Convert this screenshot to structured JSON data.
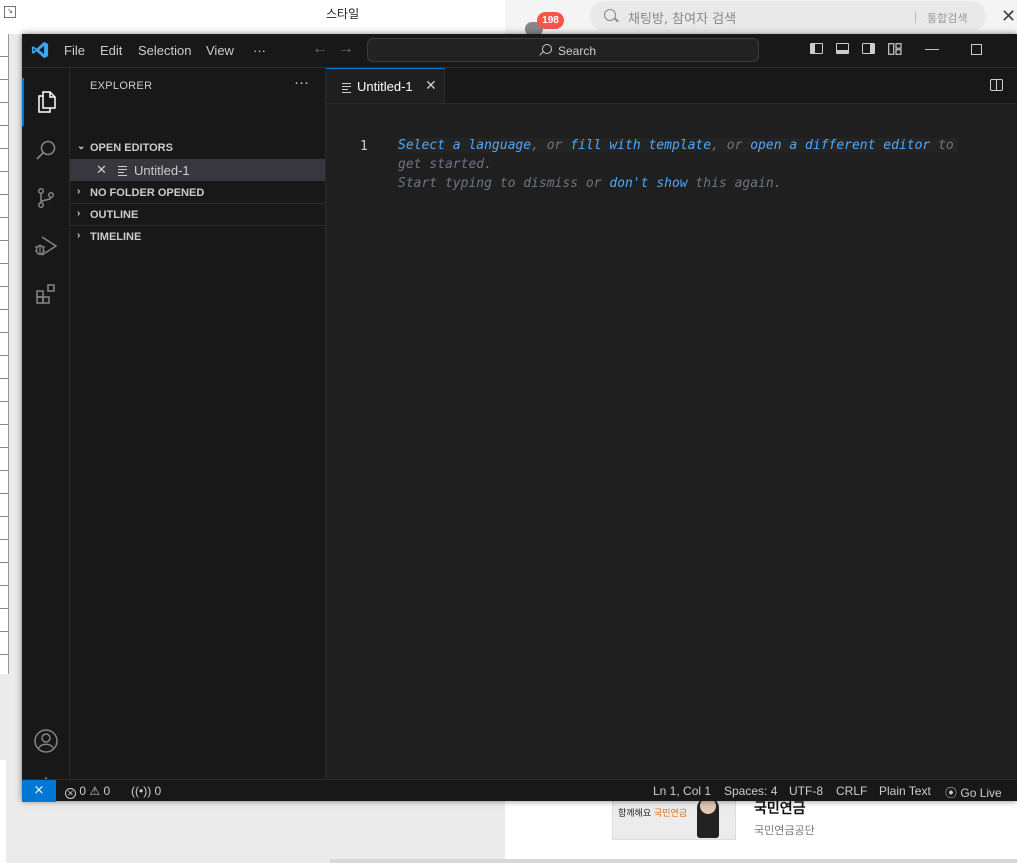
{
  "background": {
    "doc_style_label": "스타일",
    "chat_badge_count": "198",
    "chat_search_placeholder": "채팅방, 참여자 검색",
    "chat_search_button": "통합검색",
    "ad_image_text_a": "함께해요",
    "ad_image_text_b": "국민연금",
    "ad_title": "국민연금",
    "ad_subtitle": "국민연금공단"
  },
  "titlebar": {
    "menus": [
      "File",
      "Edit",
      "Selection",
      "View",
      "···"
    ],
    "search_label": "Search"
  },
  "sidebar": {
    "title": "EXPLORER",
    "more": "···",
    "sections": {
      "open_editors": "OPEN EDITORS",
      "no_folder": "NO FOLDER OPENED",
      "outline": "OUTLINE",
      "timeline": "TIMELINE"
    },
    "open_editor_file": "Untitled-1"
  },
  "editor": {
    "tab_label": "Untitled-1",
    "line_number": "1",
    "hint": {
      "select_language": "Select a language",
      "sep1": ", or ",
      "fill_template": "fill with template",
      "sep2": ", or ",
      "open_editor": "open a different editor",
      "to": " to",
      "get_started": "get started.",
      "start_typing": "Start typing to dismiss or ",
      "dont_show": "don't show",
      "this_again": " this again."
    }
  },
  "statusbar": {
    "errors": "0",
    "warnings": "0",
    "ports": "0",
    "position": "Ln 1, Col 1",
    "spaces": "Spaces: 4",
    "encoding": "UTF-8",
    "eol": "CRLF",
    "language": "Plain Text",
    "go_live": "Go Live"
  },
  "colors": {
    "accent": "#0078d4",
    "link": "#4daafc",
    "badge": "#f5554a"
  }
}
